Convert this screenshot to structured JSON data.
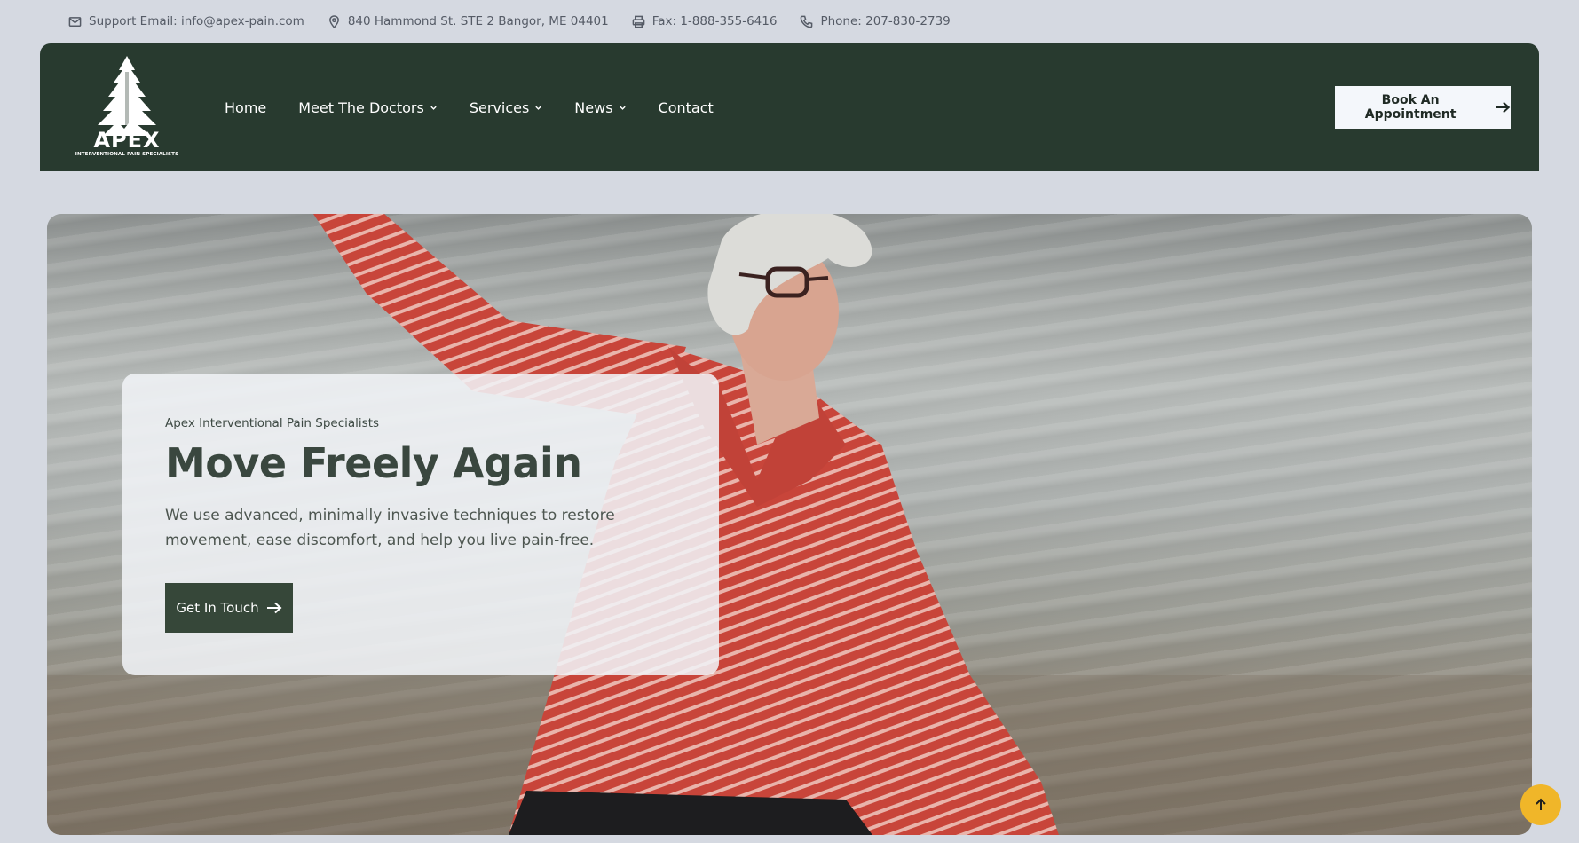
{
  "topbar": {
    "email": "Support Email: info@apex-pain.com",
    "address": "840 Hammond St. STE 2 Bangor, ME 04401",
    "fax": "Fax: 1-888-355-6416",
    "phone": "Phone: 207-830-2739"
  },
  "logo": {
    "word": "APEX",
    "subtitle": "INTERVENTIONAL PAIN SPECIALISTS"
  },
  "nav": {
    "items": [
      {
        "label": "Home"
      },
      {
        "label": "Meet The Doctors"
      },
      {
        "label": "Services"
      },
      {
        "label": "News"
      },
      {
        "label": "Contact"
      }
    ]
  },
  "header": {
    "cta_label": "Book An Appointment"
  },
  "hero": {
    "eyebrow": "Apex Interventional Pain Specialists",
    "title": "Move Freely Again",
    "description": "We use advanced, minimally invasive techniques to restore movement, ease discomfort, and help you live pain-free.",
    "button_label": "Get In Touch"
  },
  "colors": {
    "header_bg": "#283a2f",
    "page_bg": "#d5d9e1",
    "primary_button": "#364739",
    "scroll_top": "#f0b629"
  }
}
